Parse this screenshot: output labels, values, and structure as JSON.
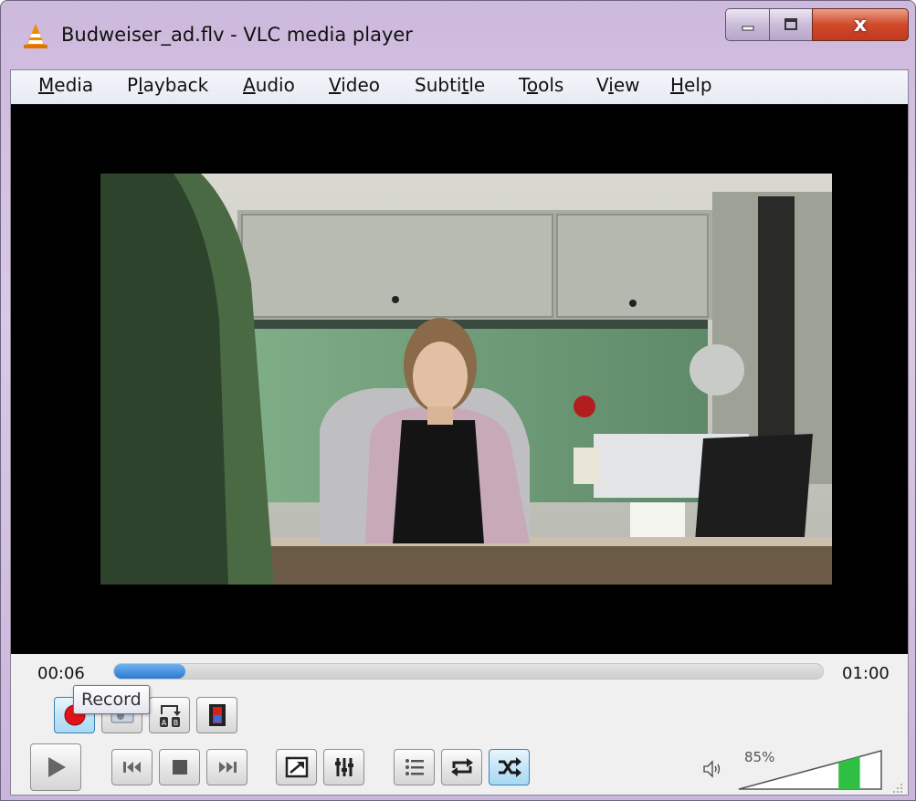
{
  "window": {
    "title": "Budweiser_ad.flv - VLC media player",
    "close_glyph": "x"
  },
  "menu": [
    {
      "label": "Media",
      "mnemonic": "M",
      "rest": "edia"
    },
    {
      "label": "Playback",
      "mnemonic_pre": "P",
      "mnemonic": "l",
      "rest": "ayback"
    },
    {
      "label": "Audio",
      "mnemonic": "A",
      "rest": "udio"
    },
    {
      "label": "Video",
      "mnemonic": "V",
      "rest": "ideo"
    },
    {
      "label": "Subtitle",
      "pre": "Subti",
      "mnemonic": "t",
      "rest": "le"
    },
    {
      "label": "Tools",
      "pre": "T",
      "mnemonic": "o",
      "rest": "ols"
    },
    {
      "label": "View",
      "pre": "V",
      "mnemonic": "i",
      "rest": "ew"
    },
    {
      "label": "Help",
      "mnemonic": "H",
      "rest": "elp"
    }
  ],
  "playback": {
    "elapsed": "00:06",
    "total": "01:00",
    "progress_fraction": 0.1
  },
  "advanced_controls": [
    {
      "name": "record-button",
      "icon": "record-icon",
      "active": true
    },
    {
      "name": "snapshot-button",
      "icon": "camera-icon",
      "active": false
    },
    {
      "name": "loop-ab-button",
      "icon": "loop-ab-icon",
      "active": false
    },
    {
      "name": "frame-by-frame-button",
      "icon": "film-frame-icon",
      "active": false
    }
  ],
  "main_controls": [
    {
      "name": "play-button",
      "icon": "play-icon"
    },
    {
      "name": "previous-button",
      "icon": "previous-icon"
    },
    {
      "name": "stop-button",
      "icon": "stop-icon"
    },
    {
      "name": "next-button",
      "icon": "next-icon"
    },
    {
      "name": "fullscreen-button",
      "icon": "fullscreen-icon"
    },
    {
      "name": "extended-settings-button",
      "icon": "sliders-icon"
    },
    {
      "name": "playlist-button",
      "icon": "playlist-icon"
    },
    {
      "name": "loop-button",
      "icon": "repeat-icon"
    },
    {
      "name": "shuffle-button",
      "icon": "shuffle-icon",
      "active": true
    }
  ],
  "tooltip": {
    "text": "Record"
  },
  "volume": {
    "label": "85%",
    "level": 0.85
  },
  "colors": {
    "accent": "#2b79d1",
    "volume_fill": "#2fc043",
    "record_red": "#e0141a"
  }
}
